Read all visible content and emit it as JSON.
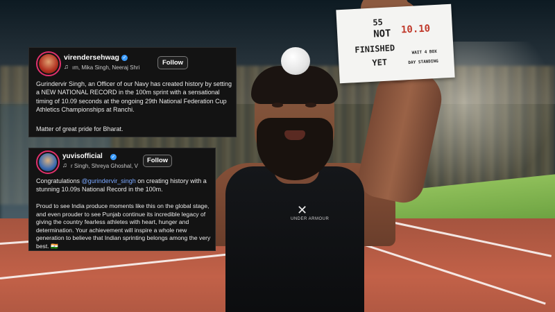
{
  "sign": {
    "line1": "55",
    "line2": "NOT",
    "line3": "FINISHED",
    "line4": "YET",
    "time": "10.10",
    "footer1": "WAIT 4 BOX",
    "footer2": "DAY STANDING"
  },
  "jersey": {
    "logo_text": "UNDER ARMOUR"
  },
  "post1": {
    "username": "virendersehwag",
    "music": "ım, Mika Singh, Neeraj Shri",
    "follow_label": "Follow",
    "body": "Gurindervir Singh, an  Officer of our Navy  has created history by setting a NEW NATIONAL RECORD in the 100m sprint with a sensational timing of 10.09 seconds at the ongoing 29th National Federation Cup Athletics Championships at Ranchi.",
    "footer": "Matter of great pride for Bharat."
  },
  "post2": {
    "username": "yuvisofficial",
    "music": "r Singh, Shreya Ghoshal, V",
    "follow_label": "Follow",
    "congrats_prefix": "Congratulations ",
    "mention": "@gurindervir_singh",
    "congrats_suffix": " on creating history with a stunning 10.09s National Record in the 100m.",
    "body": "Proud to see India produce moments like this on the global stage, and even prouder to see Punjab continue its incredible legacy of giving the country fearless athletes with heart, hunger and determination. Your achievement will inspire a whole new generation to believe that Indian sprinting belongs among the very best. 🇮🇳"
  },
  "colors": {
    "card_bg": "#131313",
    "mention": "#7aa8ff",
    "verified": "#3b9cff",
    "track": "#c26148",
    "grass": "#6aa33c"
  }
}
